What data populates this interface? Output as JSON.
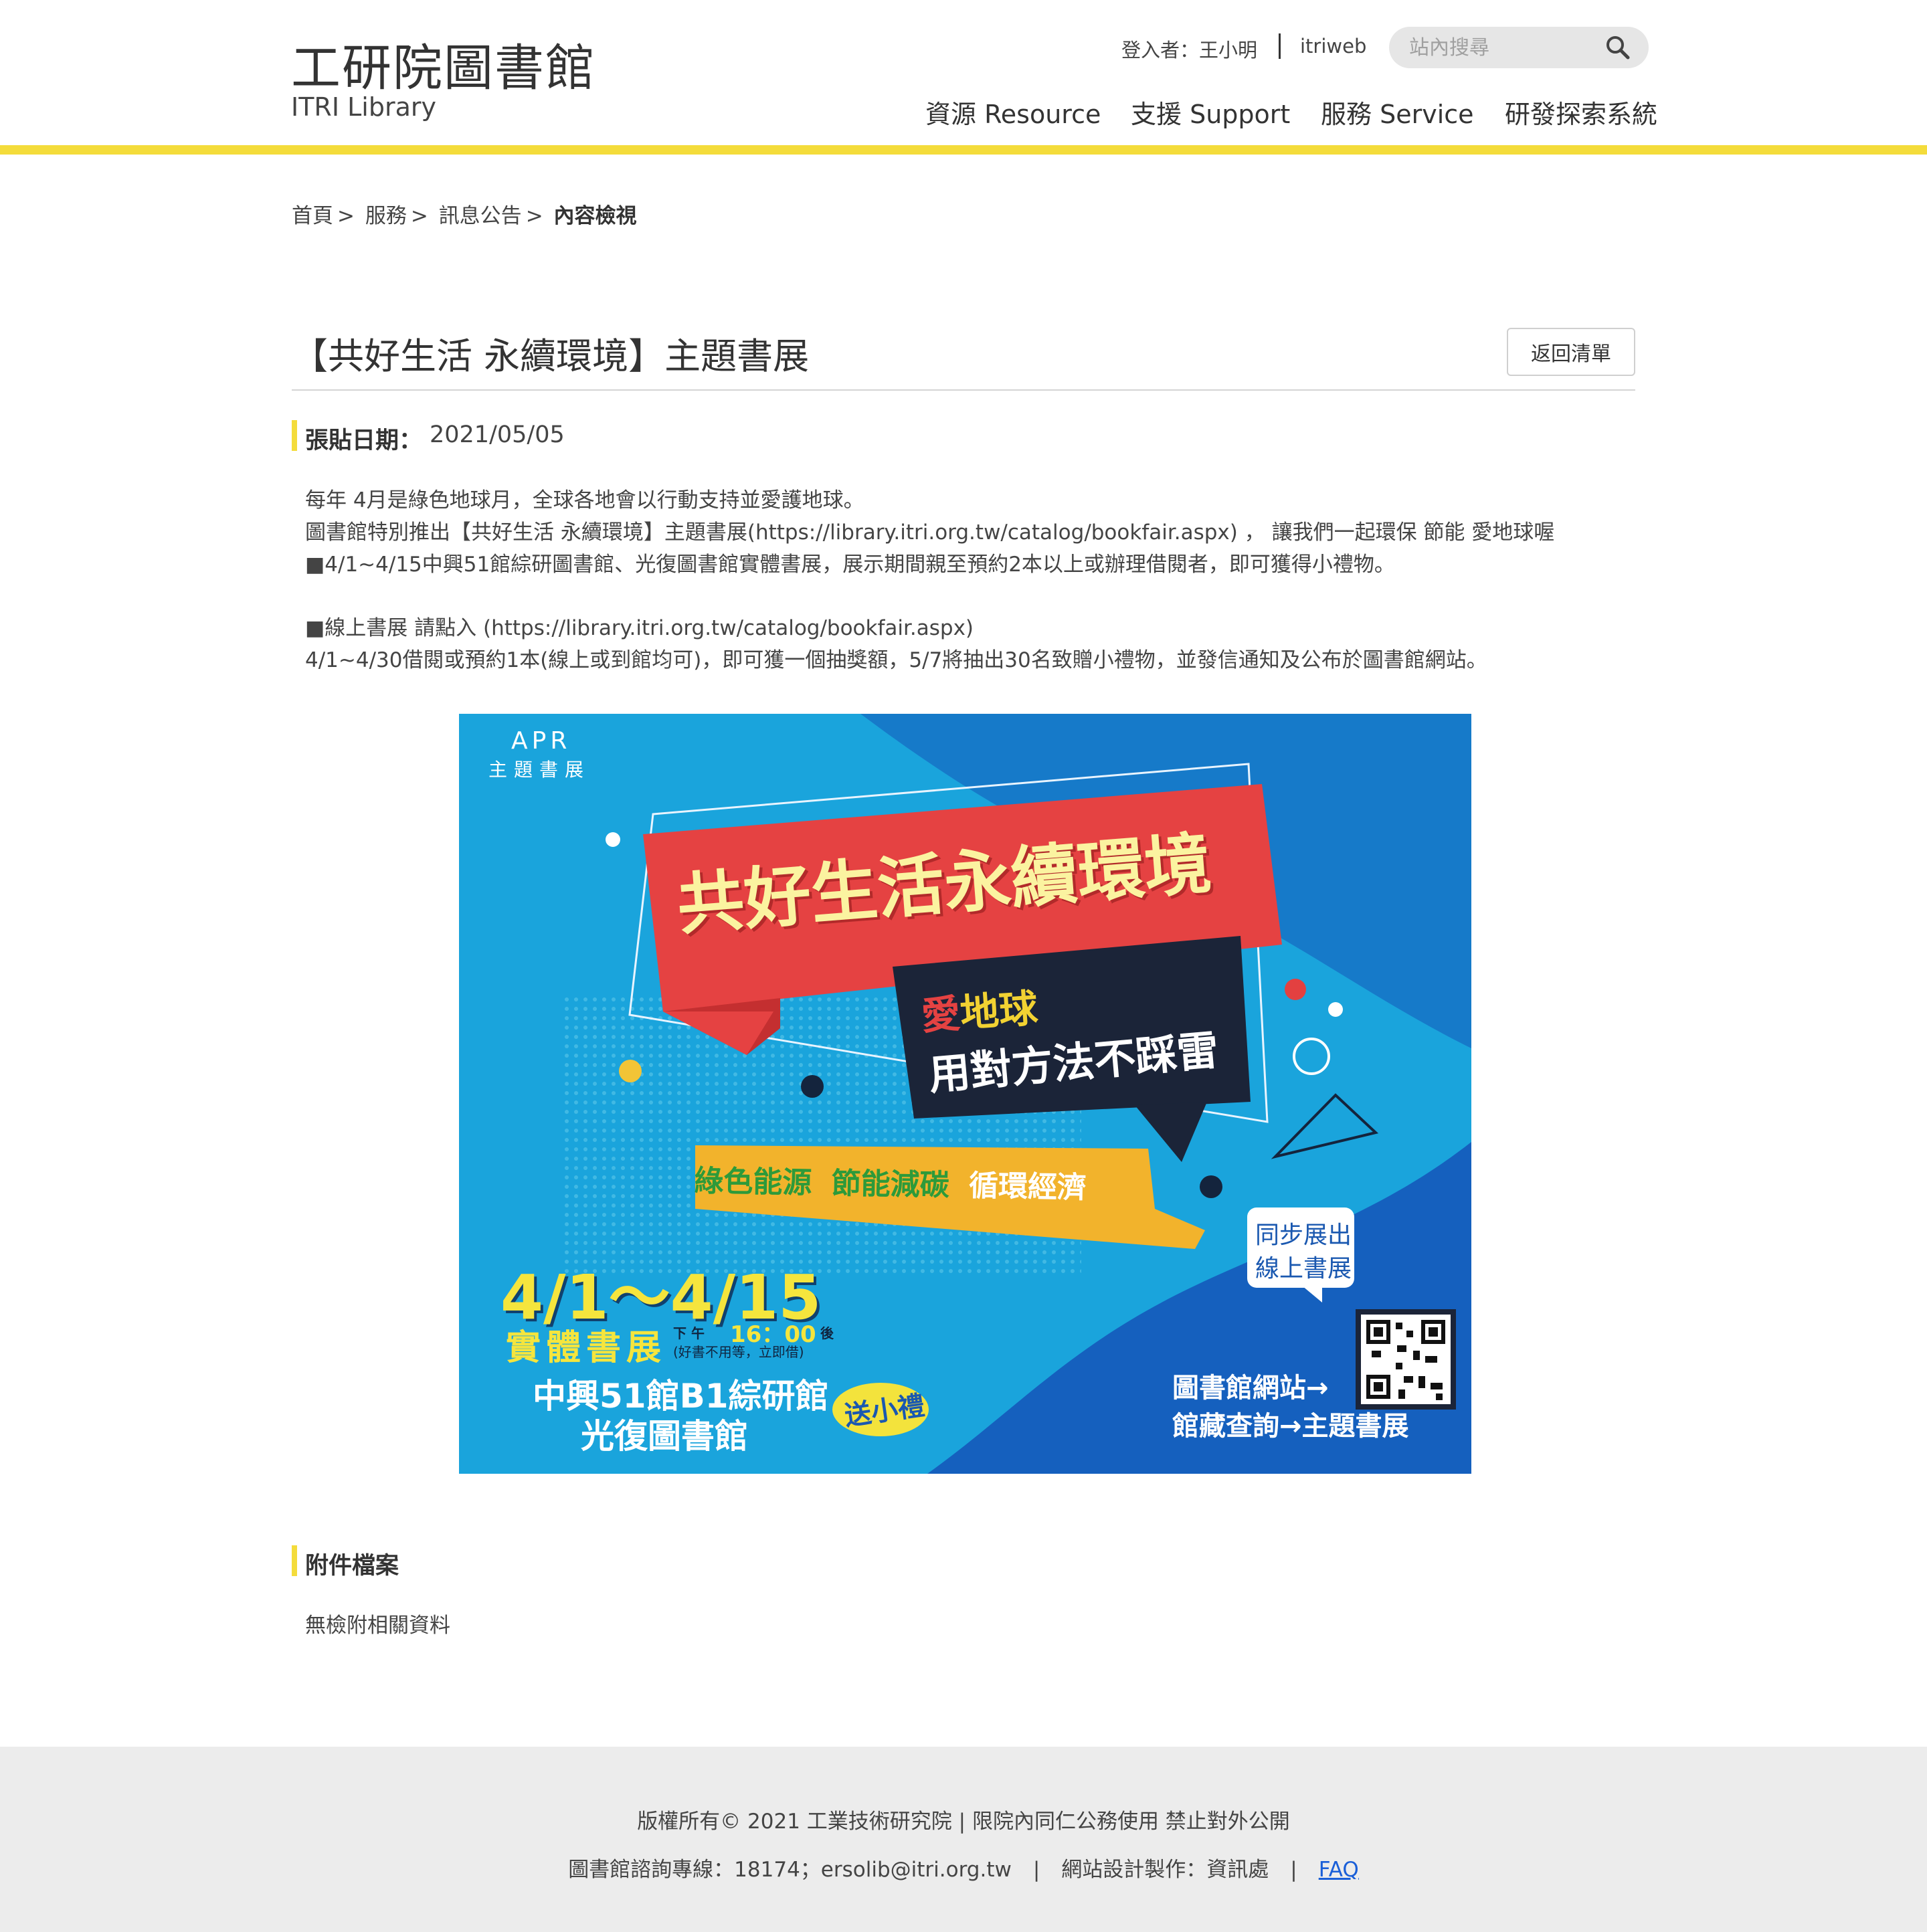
{
  "header": {
    "logo_cn": "工研院圖書館",
    "logo_en": "ITRI Library",
    "login_text": "登入者：王小明",
    "itriweb": "itriweb",
    "search_placeholder": "站內搜尋",
    "nav": [
      "資源 Resource",
      "支援 Support",
      "服務 Service",
      "研發探索系統"
    ],
    "accent_color": "#f4dc3b"
  },
  "breadcrumb": [
    "首頁",
    "服務",
    "訊息公告",
    "內容檢視"
  ],
  "article": {
    "title": "【共好生活 永續環境】主題書展",
    "back_label": "返回清單",
    "date_label": "張貼日期：",
    "date_value": "2021/05/05",
    "body": [
      "每年 4月是綠色地球月，全球各地會以行動支持並愛護地球。",
      " 圖書館特別推出【共好生活 永續環境】主題書展(https://library.itri.org.tw/catalog/bookfair.aspx) ， 讓我們一起環保 節能 愛地球喔",
      "■4/1~4/15中興51館綜研圖書館、光復圖書館實體書展，展示期間親至預約2本以上或辦理借閱者，即可獲得小禮物。",
      "",
      "■線上書展 請點入 (https://library.itri.org.tw/catalog/bookfair.aspx)",
      "4/1~4/30借閱或預約1本(線上或到館均可)，即可獲一個抽獎額，5/7將抽出30名致贈小禮物，並發信通知及公布於圖書館網站。"
    ]
  },
  "poster": {
    "apr": "APR",
    "apr_sub": "主題書展",
    "headline": "共好生活永續環境",
    "love": "愛",
    "earth": "地球",
    "method": "用對方法不踩雷",
    "green_energy": "綠色能源",
    "save_energy": "節能減碳",
    "circular": "循環經濟",
    "dates": "4/1～4/15",
    "physical": "實體書展",
    "time_prefix": "下 午",
    "time": "16：00",
    "time_suffix": "後",
    "time_note": "(好書不用等，立即借)",
    "venue1": "中興51館B1綜研館",
    "venue2": "光復圖書館",
    "gift": "送小禮",
    "online1": "同步展出",
    "online2": "線上書展",
    "site": "圖書館網站→",
    "query": "館藏查詢→主題書展"
  },
  "attachments": {
    "label": "附件檔案",
    "none_text": "無檢附相關資料"
  },
  "footer": {
    "copyright": "版權所有© 2021 工業技術研究院 | 限院內同仁公務使用 禁止對外公開",
    "contact": "圖書館諮詢專線：18174；ersolib@itri.org.tw",
    "design": "網站設計製作：資訊處",
    "faq": "FAQ",
    "sep": "|"
  }
}
